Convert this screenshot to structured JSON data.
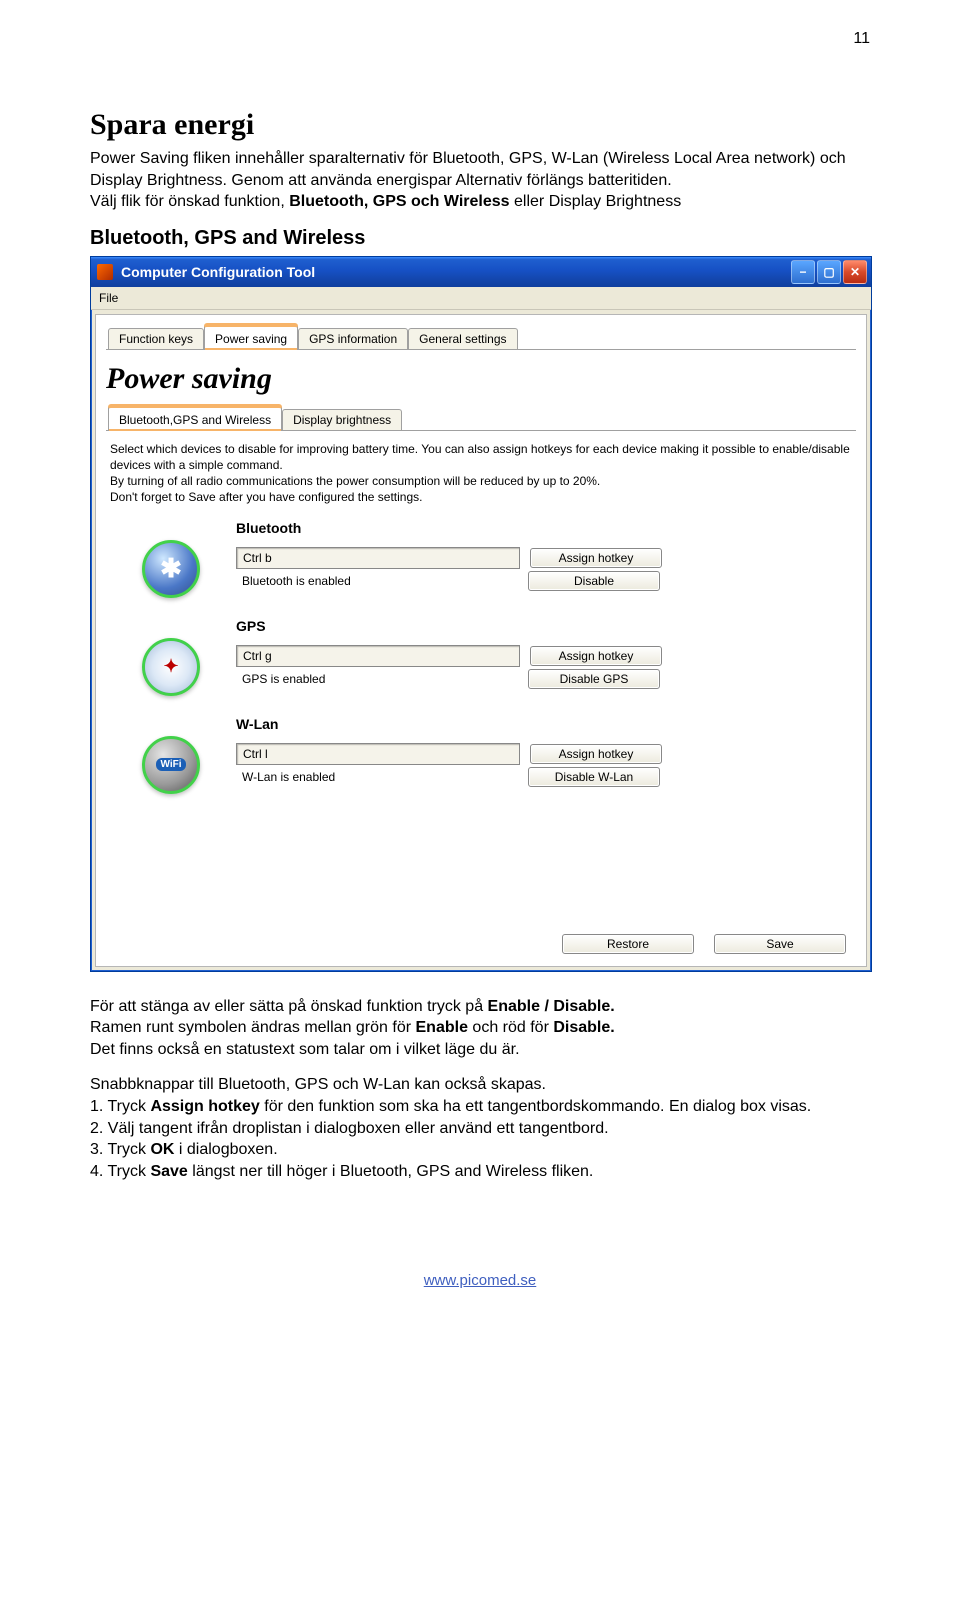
{
  "page_number": "11",
  "heading": "Spara energi",
  "intro_p1_a": "Power Saving fliken innehåller sparalternativ för Bluetooth, GPS, W-Lan (Wireless Local Area network) och Display Brightness. Genom att använda energispar Alternativ förlängs batteritiden.",
  "intro_p1_b": "Välj flik för önskad funktion, ",
  "intro_p1_bold": "Bluetooth, GPS och Wireless",
  "intro_p1_c": " eller Display Brightness",
  "subheading": "Bluetooth, GPS and Wireless",
  "window": {
    "title": "Computer Configuration Tool",
    "menu_file": "File",
    "tabs": {
      "function_keys": "Function keys",
      "power_saving": "Power saving",
      "gps_information": "GPS information",
      "general_settings": "General settings"
    },
    "panel_title": "Power saving",
    "sub_tabs": {
      "bt_gps_wireless": "Bluetooth,GPS and Wireless",
      "display_brightness": "Display brightness"
    },
    "desc_l1": "Select which devices to disable for improving battery time. You can also assign hotkeys for each device making it possible to enable/disable devices with a simple command.",
    "desc_l2": "By turning of all radio communications the power consumption will be reduced by up to 20%.",
    "desc_l3": "Don't forget to Save after you have configured the settings.",
    "devices": {
      "bluetooth": {
        "title": "Bluetooth",
        "hotkey": "Ctrl b",
        "status": "Bluetooth is enabled",
        "assign_btn": "Assign hotkey",
        "disable_btn": "Disable"
      },
      "gps": {
        "title": "GPS",
        "hotkey": "Ctrl g",
        "status": "GPS is enabled",
        "assign_btn": "Assign hotkey",
        "disable_btn": "Disable GPS"
      },
      "wlan": {
        "title": "W-Lan",
        "hotkey": "Ctrl l",
        "status": "W-Lan is enabled",
        "assign_btn": "Assign hotkey",
        "disable_btn": "Disable W-Lan"
      }
    },
    "restore_btn": "Restore",
    "save_btn": "Save"
  },
  "post_p1_a": "För att stänga av eller sätta på önskad funktion tryck på ",
  "post_p1_bold1": "Enable / Disable.",
  "post_p2_a": "Ramen runt symbolen ändras mellan grön för ",
  "post_p2_bold1": "Enable",
  "post_p2_b": " och röd för ",
  "post_p2_bold2": "Disable.",
  "post_p3": "Det finns också en statustext som talar om i vilket läge du är.",
  "post2_l1": "Snabbknappar till Bluetooth, GPS och W-Lan kan också skapas.",
  "post2_l2_a": "1. Tryck ",
  "post2_l2_bold": "Assign hotkey",
  "post2_l2_b": " för den funktion som ska ha ett tangentbordskommando. En dialog box visas.",
  "post2_l3": "2. Välj tangent ifrån droplistan i dialogboxen eller använd ett tangentbord.",
  "post2_l4_a": "3. Tryck ",
  "post2_l4_bold": "OK",
  "post2_l4_b": " i dialogboxen.",
  "post2_l5_a": "4. Tryck ",
  "post2_l5_bold": "Save",
  "post2_l5_b": " längst ner till höger i Bluetooth, GPS and Wireless fliken.",
  "footer_url": "www.picomed.se"
}
